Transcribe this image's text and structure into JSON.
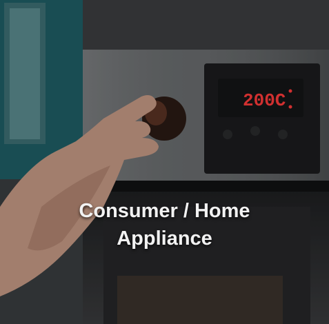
{
  "tile": {
    "caption_line1": "Consumer / Home",
    "caption_line2": "Appliance"
  },
  "oven": {
    "display_readout": "200C"
  },
  "colors": {
    "display_digits": "#ff3b3b",
    "caption_text": "#f2f2f2",
    "wall_teal": "#1f5f66"
  }
}
